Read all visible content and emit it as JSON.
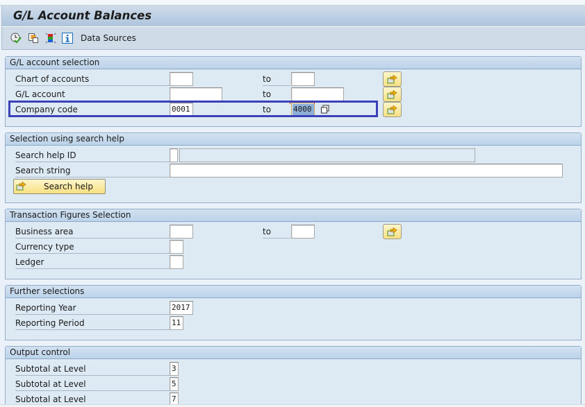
{
  "window": {
    "title": "G/L Account Balances"
  },
  "toolbar": {
    "icons": [
      {
        "name": "execute-icon",
        "label": "Execute"
      },
      {
        "name": "get-variant-icon",
        "label": "Get Variant"
      },
      {
        "name": "dynamic-selections-icon",
        "label": "Dynamic Selections"
      },
      {
        "name": "info-icon",
        "label": "Information"
      }
    ],
    "data_sources_label": "Data Sources"
  },
  "groups": {
    "gl_account_selection": {
      "title": "G/L account selection",
      "rows": [
        {
          "label": "Chart of accounts",
          "from": "",
          "to_label": "to",
          "to": ""
        },
        {
          "label": "G/L account",
          "from": "",
          "to_label": "to",
          "to": ""
        },
        {
          "label": "Company code",
          "from": "0001",
          "to_label": "to",
          "to": "4000"
        }
      ]
    },
    "search_help": {
      "title": "Selection using search help",
      "rows": [
        {
          "label": "Search help ID",
          "value": "",
          "description": ""
        },
        {
          "label": "Search string",
          "value": ""
        }
      ],
      "button_label": "Search help"
    },
    "transaction_figures": {
      "title": "Transaction Figures Selection",
      "rows": [
        {
          "label": "Business area",
          "from": "",
          "to_label": "to",
          "to": ""
        },
        {
          "label": "Currency type",
          "value": ""
        },
        {
          "label": "Ledger",
          "value": ""
        }
      ]
    },
    "further_selections": {
      "title": "Further selections",
      "rows": [
        {
          "label": "Reporting Year",
          "value": "2017"
        },
        {
          "label": "Reporting Period",
          "value": "11"
        }
      ]
    },
    "output_control": {
      "title": "Output control",
      "rows": [
        {
          "label": "Subtotal at Level",
          "value": "3"
        },
        {
          "label": "Subtotal at Level",
          "value": "5"
        },
        {
          "label": "Subtotal at Level",
          "value": "7"
        }
      ]
    }
  },
  "colors": {
    "highlight_border": "#3b3fb8",
    "selection_button": "#f6df84",
    "group_header": "#bcd3ea"
  }
}
